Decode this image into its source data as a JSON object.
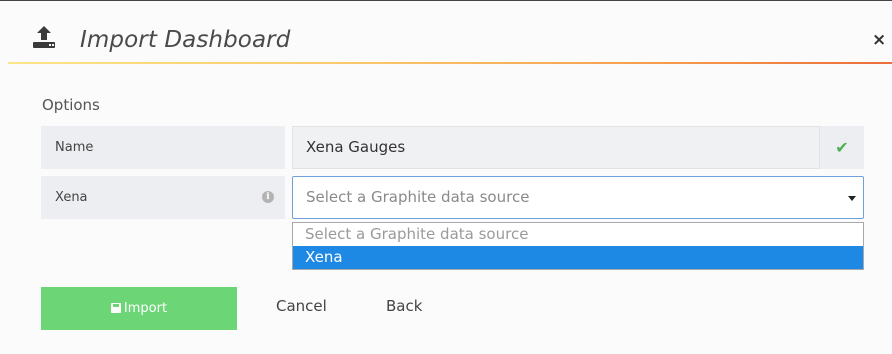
{
  "dialog": {
    "title": "Import Dashboard",
    "close_label": "×",
    "icons": {
      "header": "upload-icon",
      "close": "close-icon",
      "info": "info-icon",
      "check": "check-icon",
      "import": "save-icon"
    }
  },
  "options": {
    "section_title": "Options",
    "name_row": {
      "label": "Name",
      "value": "Xena Gauges",
      "valid": true
    },
    "datasource_row": {
      "label": "Xena",
      "info_symbol": "i",
      "select_placeholder": "Select a Graphite data source",
      "dropdown_open": true,
      "dropdown_options": [
        {
          "label": "Select a Graphite data source",
          "placeholder": true,
          "highlighted": false
        },
        {
          "label": "Xena",
          "placeholder": false,
          "highlighted": true
        }
      ]
    }
  },
  "actions": {
    "import_label": "Import",
    "cancel_label": "Cancel",
    "back_label": "Back"
  },
  "colors": {
    "accent_green": "#6cd676",
    "select_focus": "#6ea2d9",
    "option_highlight": "#1e88e5",
    "valid_check": "#4caf50"
  }
}
